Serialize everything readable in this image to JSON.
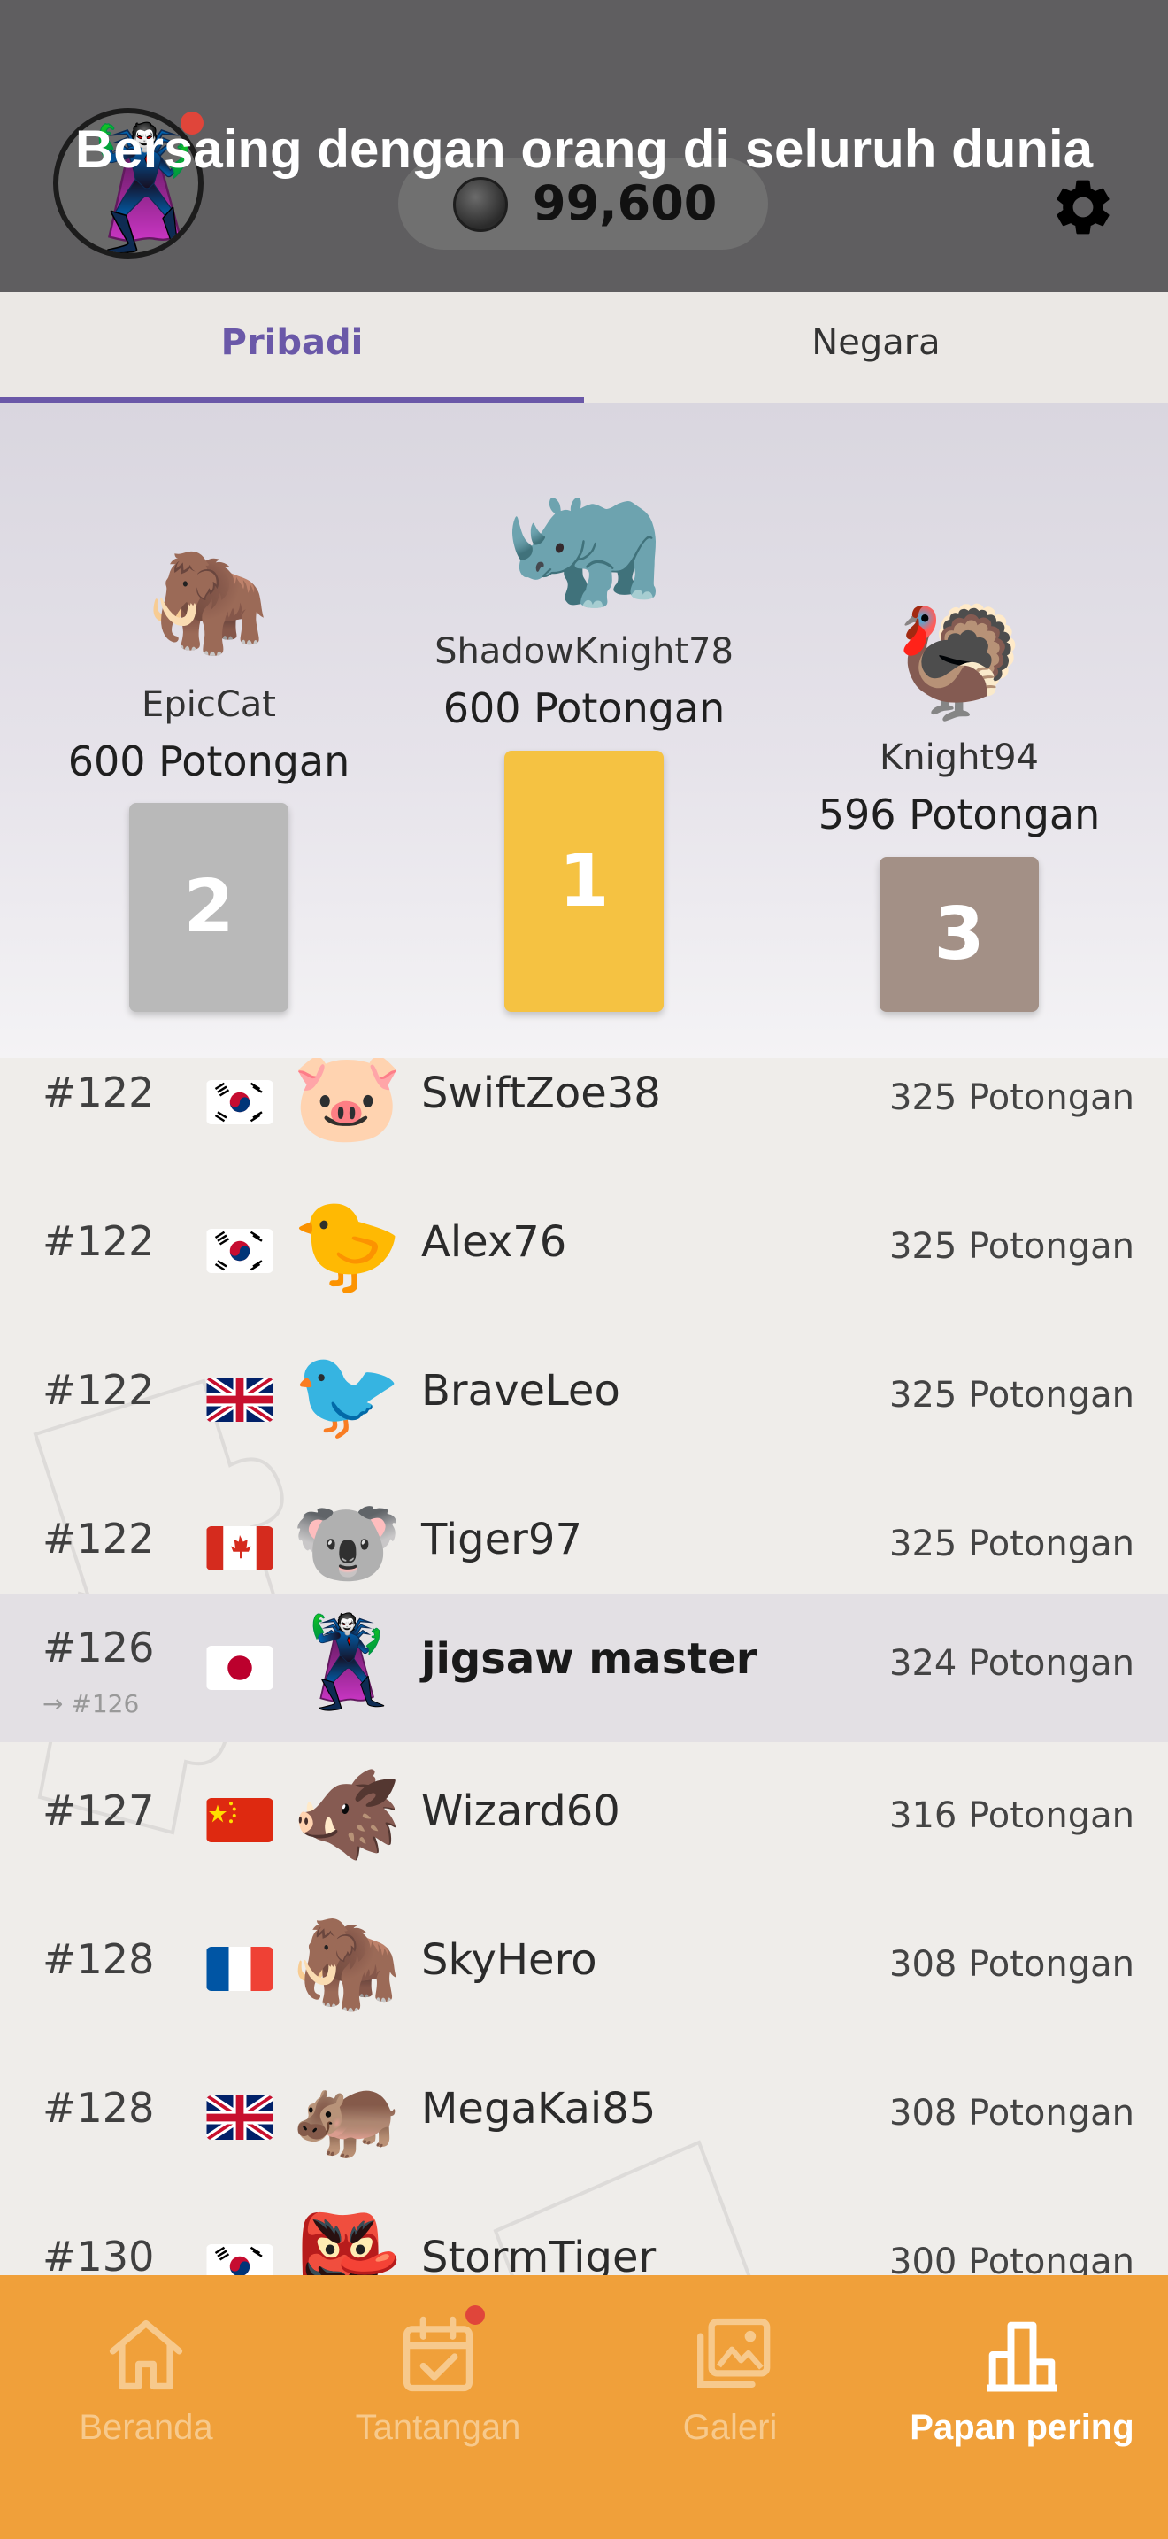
{
  "header": {
    "title": "Bersaing dengan orang di seluruh dunia",
    "coins": "99,600",
    "avatar_emoji": "🦹",
    "avatar_notification": true,
    "settings_icon": "gear-icon"
  },
  "tabs": [
    {
      "label": "Pribadi",
      "active": true
    },
    {
      "label": "Negara",
      "active": false
    }
  ],
  "podium": {
    "first": {
      "rank": "1",
      "name": "ShadowKnight78",
      "points": "600 Potongan",
      "emoji": "🦏",
      "color": "#f5c242"
    },
    "second": {
      "rank": "2",
      "name": "EpicCat",
      "points": "600 Potongan",
      "emoji": "🦣",
      "color": "#b9b9b9"
    },
    "third": {
      "rank": "3",
      "name": "Knight94",
      "points": "596 Potongan",
      "emoji": "🦃",
      "color": "#a39086"
    }
  },
  "rows": [
    {
      "rank": "#122",
      "flag": "kr",
      "emoji": "🐷",
      "name": "SwiftZoe38",
      "points": "325 Potongan"
    },
    {
      "rank": "#122",
      "flag": "kr",
      "emoji": "🐤",
      "name": "Alex76",
      "points": "325 Potongan"
    },
    {
      "rank": "#122",
      "flag": "gb",
      "emoji": "🐦",
      "name": "BraveLeo",
      "points": "325 Potongan"
    },
    {
      "rank": "#122",
      "flag": "ca",
      "emoji": "🐨",
      "name": "Tiger97",
      "points": "325 Potongan"
    },
    {
      "rank": "#126",
      "rank_sub": "→ #126",
      "flag": "jp",
      "emoji": "🦹",
      "name": "jigsaw master",
      "points": "324 Potongan",
      "is_me": true
    },
    {
      "rank": "#127",
      "flag": "cn",
      "emoji": "🐗",
      "name": "Wizard60",
      "points": "316 Potongan"
    },
    {
      "rank": "#128",
      "flag": "fr",
      "emoji": "🦣",
      "name": "SkyHero",
      "points": "308 Potongan"
    },
    {
      "rank": "#128",
      "flag": "gb",
      "emoji": "🦛",
      "name": "MegaKai85",
      "points": "308 Potongan"
    },
    {
      "rank": "#130",
      "flag": "kr",
      "emoji": "👺",
      "name": "StormTiger",
      "points": "300 Potongan"
    }
  ],
  "nav": [
    {
      "label": "Beranda",
      "icon": "home-icon",
      "active": false,
      "badge": false
    },
    {
      "label": "Tantangan",
      "icon": "calendar-check-icon",
      "active": false,
      "badge": true
    },
    {
      "label": "Galeri",
      "icon": "gallery-icon",
      "active": false,
      "badge": false
    },
    {
      "label": "Papan pering",
      "icon": "leaderboard-icon",
      "active": true,
      "badge": false
    }
  ],
  "colors": {
    "accent": "#6a58a8",
    "nav_bg": "#f0a03a",
    "header_bg": "#5f5e60"
  }
}
